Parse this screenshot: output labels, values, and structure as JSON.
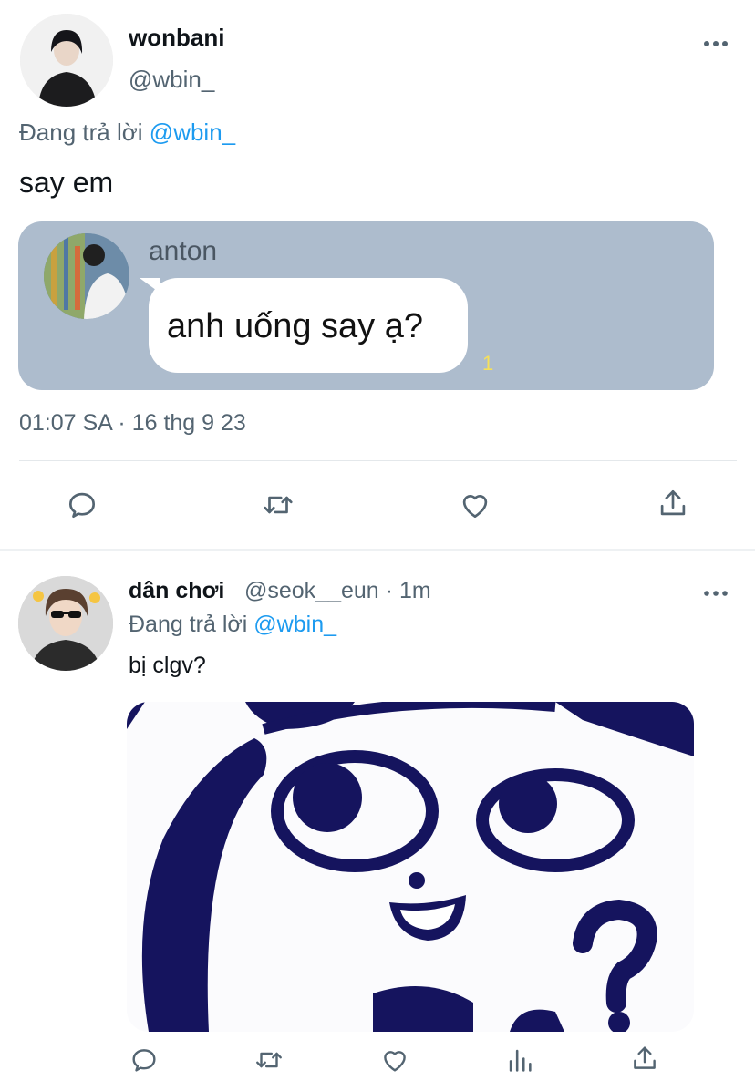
{
  "main_tweet": {
    "display_name": "wonbani",
    "handle": "@wbin_",
    "reply_prefix": "Đang trả lời",
    "reply_to": "@wbin_",
    "text": "say em",
    "quote": {
      "name": "anton",
      "message": "anh uống say ạ?",
      "count": "1"
    },
    "timestamp": "01:07 SA · 16 thg 9 23"
  },
  "reply_tweet": {
    "display_name": "dân chơi",
    "handle": "@seok__eun",
    "time": "· 1m",
    "reply_prefix": "Đang trả lời",
    "reply_to": "@wbin_",
    "text": "bị clgv?"
  },
  "icons": {
    "reply": "reply-icon",
    "retweet": "retweet-icon",
    "like": "heart-icon",
    "share": "share-icon",
    "views": "views-icon",
    "more": "more-icon"
  },
  "colors": {
    "link": "#1d9bf0",
    "muted": "#536471",
    "quote_bg": "#adbccd",
    "icon": "#536471"
  }
}
